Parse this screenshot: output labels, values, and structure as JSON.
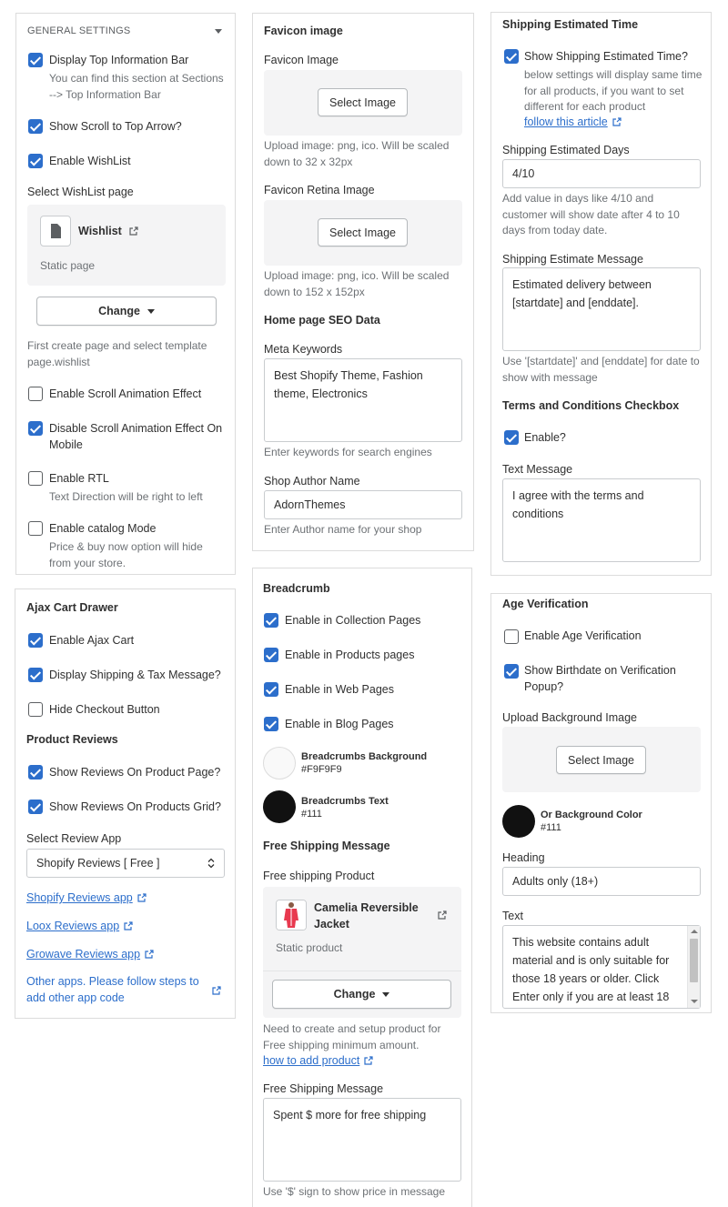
{
  "general": {
    "section_title": "GENERAL SETTINGS",
    "top_bar": {
      "label": "Display Top Information Bar",
      "checked": true,
      "help": "You can find this section at Sections --> Top Information Bar"
    },
    "scroll_top": {
      "label": "Show Scroll to Top Arrow?",
      "checked": true
    },
    "wishlist": {
      "label": "Enable WishList",
      "checked": true
    },
    "wishlist_page_label": "Select WishList page",
    "wishlist_page_name": "Wishlist",
    "wishlist_page_type": "Static page",
    "change_label": "Change",
    "wishlist_help": "First create page and select template page.wishlist",
    "scroll_anim": {
      "label": "Enable Scroll Animation Effect",
      "checked": false
    },
    "scroll_anim_mobile": {
      "label": "Disable Scroll Animation Effect On Mobile",
      "checked": true
    },
    "rtl": {
      "label": "Enable RTL",
      "checked": false,
      "help": "Text Direction will be right to left"
    },
    "catalog": {
      "label": "Enable catalog Mode",
      "checked": false,
      "help": "Price & buy now option will hide from your store."
    }
  },
  "favicon": {
    "title": "Favicon image",
    "favicon_label": "Favicon Image",
    "select_image": "Select Image",
    "favicon_help": "Upload image: png, ico. Will be scaled down to 32 x 32px",
    "retina_label": "Favicon Retina Image",
    "retina_help": "Upload image: png, ico. Will be scaled down to 152 x 152px",
    "seo_title": "Home page SEO Data",
    "meta_label": "Meta Keywords",
    "meta_value": "Best Shopify Theme, Fashion theme, Electronics",
    "meta_help": "Enter keywords for search engines",
    "author_label": "Shop Author Name",
    "author_value": "AdornThemes",
    "author_help": "Enter Author name for your shop"
  },
  "shipping_time": {
    "title": "Shipping Estimated Time",
    "show": {
      "label": "Show Shipping Estimated Time?",
      "checked": true,
      "help": "below settings will display same time for all products, if you want to set different for each product",
      "link": "follow this article"
    },
    "days_label": "Shipping Estimated Days",
    "days_value": "4/10",
    "days_help": "Add value in days like 4/10 and customer will show date after 4 to 10 days from today date.",
    "message_label": "Shipping Estimate Message",
    "message_value": "Estimated delivery between [startdate] and [enddate].",
    "message_help": "Use '[startdate]' and [enddate] for date to show with message",
    "terms_title": "Terms and Conditions Checkbox",
    "terms_enable": {
      "label": "Enable?",
      "checked": true
    },
    "text_message_label": "Text Message",
    "text_message_value": "I agree with the terms and conditions"
  },
  "ajax": {
    "title": "Ajax Cart Drawer",
    "enable": {
      "label": "Enable Ajax Cart",
      "checked": true
    },
    "shipping_tax": {
      "label": "Display Shipping & Tax Message?",
      "checked": true
    },
    "hide_checkout": {
      "label": "Hide Checkout Button",
      "checked": false
    },
    "reviews_title": "Product Reviews",
    "reviews_page": {
      "label": "Show Reviews On Product Page?",
      "checked": true
    },
    "reviews_grid": {
      "label": "Show Reviews On Products Grid?",
      "checked": true
    },
    "review_app_label": "Select Review App",
    "review_app_value": "Shopify Reviews [ Free ]",
    "link_shopify": "Shopify Reviews app",
    "link_loox": "Loox Reviews app",
    "link_growave": "Growave Reviews app",
    "link_other": "Other apps. Please follow steps to add other app code"
  },
  "breadcrumb": {
    "title": "Breadcrumb",
    "collection": {
      "label": "Enable in Collection Pages",
      "checked": true
    },
    "products": {
      "label": "Enable in Products pages",
      "checked": true
    },
    "web": {
      "label": "Enable in Web Pages",
      "checked": true
    },
    "blog": {
      "label": "Enable in Blog Pages",
      "checked": true
    },
    "bg_label": "Breadcrumbs Background",
    "bg_value": "#F9F9F9",
    "bg_color": "#F9F9F9",
    "text_label": "Breadcrumbs Text",
    "text_value": "#111",
    "text_color": "#111111",
    "free_title": "Free Shipping Message",
    "free_product_label": "Free shipping Product",
    "product_name": "Camelia Reversible Jacket",
    "product_type": "Static product",
    "change_label": "Change",
    "product_help": "Need to create and setup product for Free shipping minimum amount.",
    "product_link": "how to add product",
    "free_message_label": "Free Shipping Message",
    "free_message_value": "Spent $ more for free shipping",
    "free_message_help": "Use '$' sign to show price in message"
  },
  "age": {
    "title": "Age Verification",
    "enable": {
      "label": "Enable Age Verification",
      "checked": false
    },
    "birthdate": {
      "label": "Show Birthdate on Verification Popup?",
      "checked": true
    },
    "bg_image_label": "Upload Background Image",
    "select_image": "Select Image",
    "bg_color_label": "Or Background Color",
    "bg_color_value": "#111",
    "bg_color": "#111111",
    "heading_label": "Heading",
    "heading_value": "Adults only (18+)",
    "text_label": "Text",
    "text_value": "This website contains adult material and is only suitable for those 18 years or older. Click Enter only if you are at least 18"
  }
}
